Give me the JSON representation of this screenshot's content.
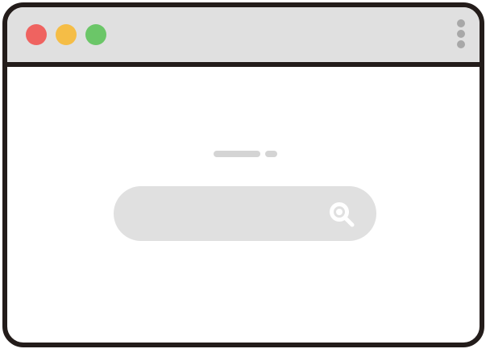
{
  "window": {
    "controls": [
      {
        "name": "close",
        "color": "#ef6360"
      },
      {
        "name": "minimize",
        "color": "#f5bd46"
      },
      {
        "name": "maximize",
        "color": "#6bc668"
      }
    ],
    "menu_icon": "kebab-menu-icon"
  },
  "search": {
    "value": "",
    "placeholder": "",
    "button_icon": "search-icon"
  },
  "colors": {
    "frame": "#231c1a",
    "titlebar": "#e0e0e0",
    "search_bar": "#e0e0e0",
    "placeholder_lines": "#d4d4d4",
    "icon_white": "#ffffff",
    "menu_dots": "#a8a8a8"
  }
}
